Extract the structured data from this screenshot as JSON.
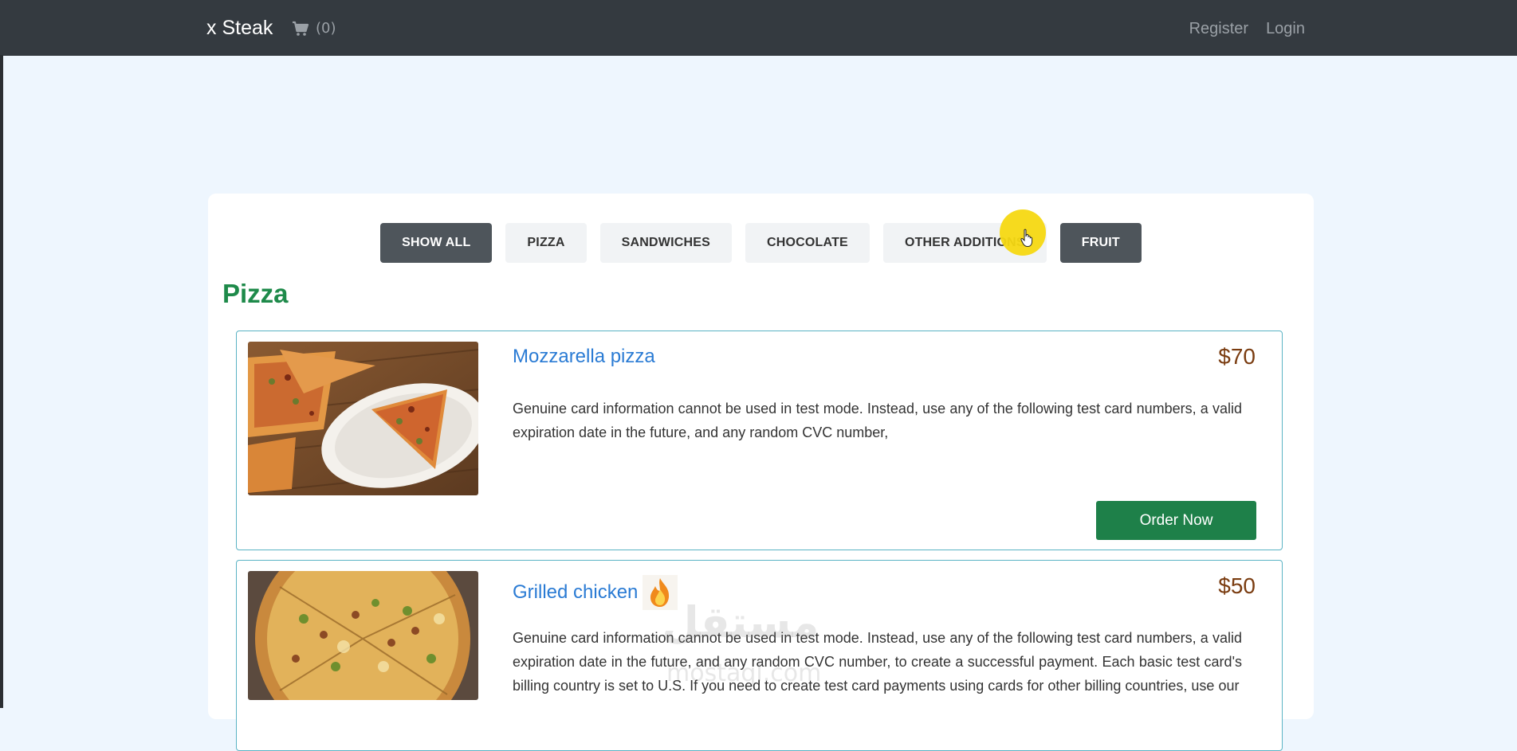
{
  "navbar": {
    "brand": "x Steak",
    "cart_count": "(0)",
    "register": "Register",
    "login": "Login"
  },
  "filters": [
    "SHOW ALL",
    "PIZZA",
    "SANDWICHES",
    "CHOCOLATE",
    "OTHER ADDITIONS",
    "FRUIT"
  ],
  "section": {
    "title": "Pizza"
  },
  "products": [
    {
      "name": "Mozzarella pizza",
      "price": "$70",
      "description": "Genuine card information cannot be used in test mode. Instead, use any of the following test card numbers, a valid expiration date in the future, and any random CVC number,",
      "button": "Order Now",
      "image": "pizza-slices-on-plate"
    },
    {
      "name": "Grilled chicken",
      "price": "$50",
      "description": "Genuine card information cannot be used in test mode. Instead, use any of the following test card numbers, a valid expiration date in the future, and any random CVC number, to create a successful payment. Each basic test card's billing country is set to U.S. If you need to create test card payments using cards for other billing countries, use our",
      "image": "grilled-chicken-pizza",
      "badge_icon": "fire-icon"
    }
  ],
  "watermark": {
    "text": "مستقل",
    "sub": "mostaql.com"
  },
  "colors": {
    "navbar": "#343a40",
    "page_bg": "#eef6fe",
    "title_green": "#1e8a4a",
    "link_blue": "#2a7bd4",
    "price_brown": "#7a3c10",
    "button_green": "#1e8049",
    "card_border": "#5ab3c4",
    "cursor_highlight": "#f6d812"
  }
}
